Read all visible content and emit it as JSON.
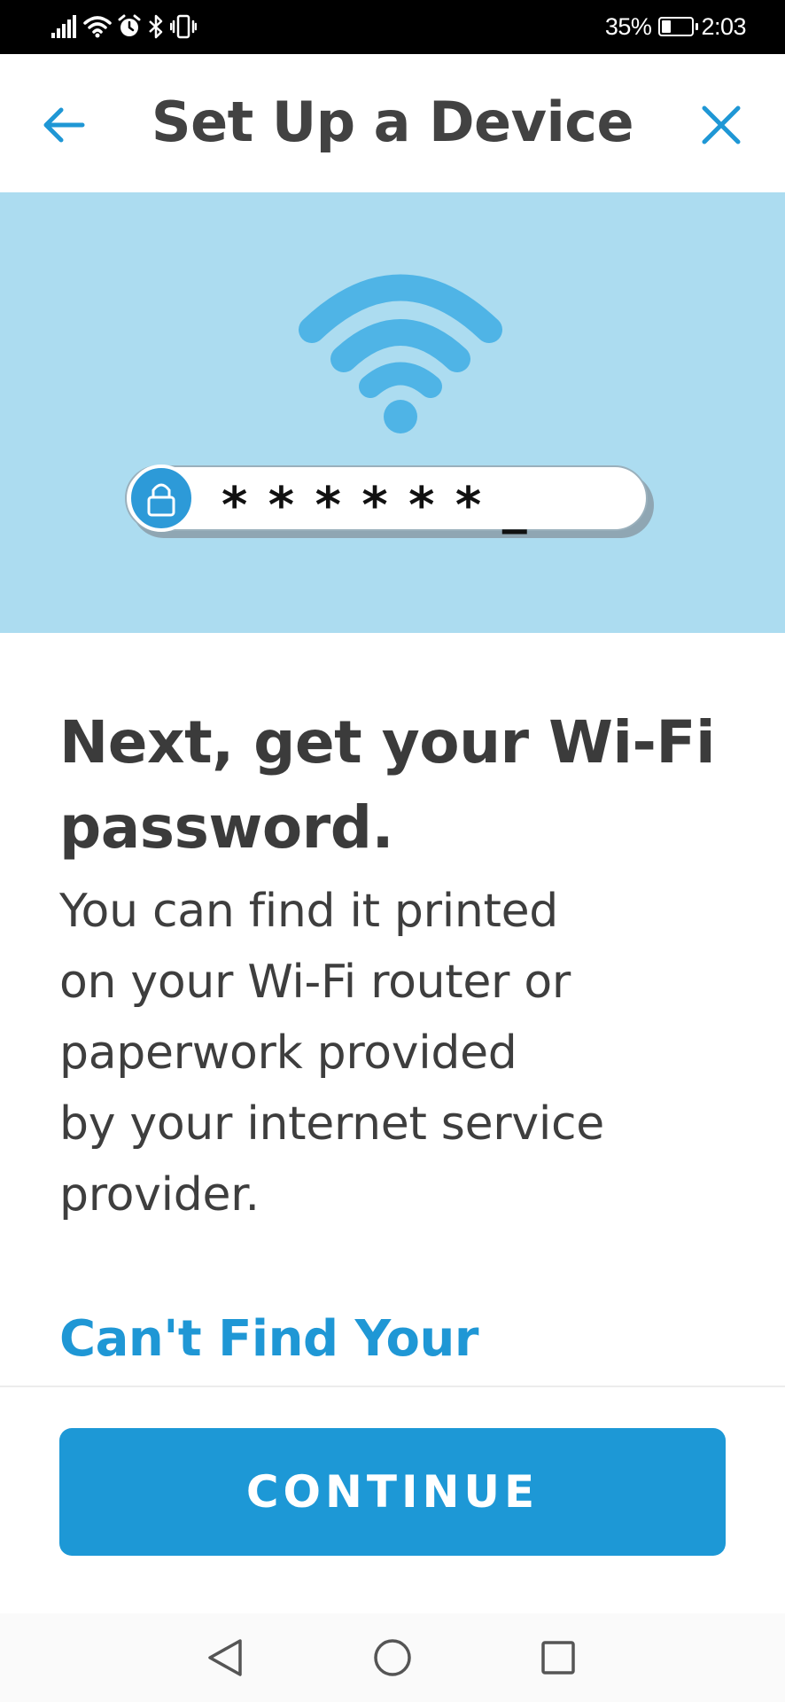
{
  "status_bar": {
    "battery_percent": "35%",
    "time": "2:03",
    "icons": [
      "signal-icon",
      "wifi-icon",
      "alarm-icon",
      "bluetooth-icon",
      "vibrate-icon"
    ]
  },
  "header": {
    "title": "Set Up a Device",
    "back_icon": "arrow-left-icon",
    "close_icon": "close-icon"
  },
  "hero": {
    "password_mask": "* * * * * * _"
  },
  "main": {
    "heading_line1": "Next, get your Wi-Fi",
    "heading_line2": "password.",
    "body_lines": [
      "You can find it printed",
      "on your Wi-Fi router or",
      "paperwork provided",
      "by your internet service",
      "provider."
    ],
    "help_link": "Can't Find Your"
  },
  "footer": {
    "continue_label": "CONTINUE"
  },
  "colors": {
    "accent": "#1d98d6",
    "hero_bg": "#acdcf0",
    "wifi_blue": "#4fb4e6",
    "text_dark": "#3b3b3b"
  }
}
